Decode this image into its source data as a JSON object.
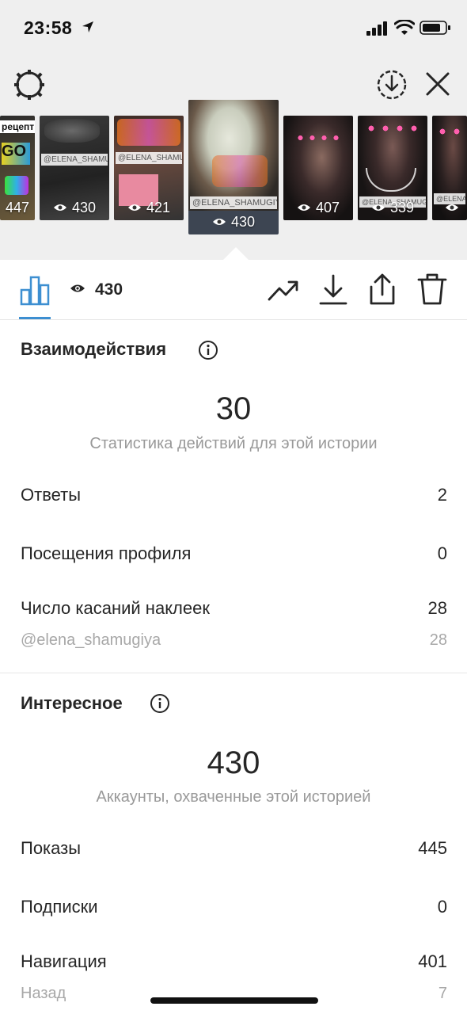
{
  "status_bar": {
    "time": "23:58",
    "icons": [
      "location-arrow-icon",
      "signal-icon",
      "wifi-icon",
      "battery-icon"
    ]
  },
  "header": {
    "icons": [
      "gear-icon",
      "download-circle-icon",
      "close-icon"
    ]
  },
  "stories": [
    {
      "views": "447",
      "tag": "",
      "sticker": "рецепт"
    },
    {
      "views": "430",
      "tag": "@ELENA_SHAMUGIYA"
    },
    {
      "views": "421",
      "tag": "@ELENA_SHAMUGIYA"
    },
    {
      "views": "430",
      "tag": "@ELENA_SHAMUGIYA",
      "selected": true
    },
    {
      "views": "407",
      "tag": ""
    },
    {
      "views": "339",
      "tag": "@ELENA_SHAMUGIYA"
    },
    {
      "views": "",
      "tag": "@ELENA"
    }
  ],
  "toolbar": {
    "view_count": "430",
    "icons": [
      "bar-chart-icon",
      "eye-icon",
      "trending-icon",
      "download-icon",
      "share-icon",
      "trash-icon"
    ]
  },
  "interactions": {
    "title": "Взаимодействия",
    "total": "30",
    "caption": "Статистика действий для этой истории",
    "rows": [
      {
        "label": "Ответы",
        "value": "2"
      },
      {
        "label": "Посещения профиля",
        "value": "0"
      },
      {
        "label": "Число касаний наклеек",
        "value": "28"
      }
    ],
    "sub_row": {
      "label": "@elena_shamugiya",
      "value": "28"
    }
  },
  "discovery": {
    "title": "Интересное",
    "total": "430",
    "caption": "Аккаунты, охваченные этой историей",
    "rows": [
      {
        "label": "Показы",
        "value": "445"
      },
      {
        "label": "Подписки",
        "value": "0"
      },
      {
        "label": "Навигация",
        "value": "401"
      }
    ],
    "sub_row": {
      "label": "Назад",
      "value": "7"
    }
  },
  "colors": {
    "accent": "#3d8fd1",
    "header_bg": "#efefef",
    "text": "#262626",
    "secondary_text": "#999999"
  }
}
